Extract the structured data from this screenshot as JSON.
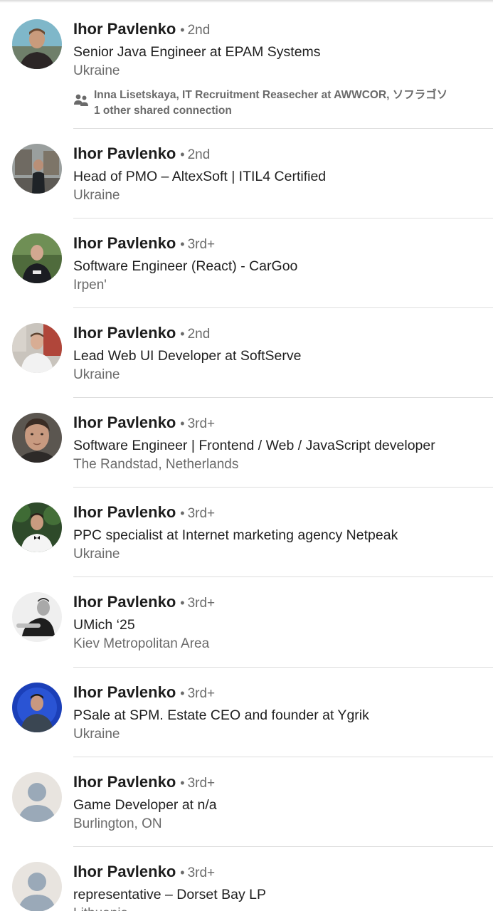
{
  "results": [
    {
      "name": "Ihor Pavlenko",
      "separator": "•",
      "degree": "2nd",
      "headline": "Senior Java Engineer at EPAM Systems",
      "location": "Ukraine",
      "avatar": "photo",
      "shared": {
        "icon": "people-icon",
        "line1": "Inna Lisetskaya, IT Recruitment Reasecher at AWWCOR, ソフラゴソ",
        "line2": "1 other shared connection"
      }
    },
    {
      "name": "Ihor Pavlenko",
      "separator": "•",
      "degree": "2nd",
      "headline": "Head of PMO – AltexSoft | ITIL4 Certified",
      "location": "Ukraine",
      "avatar": "photo"
    },
    {
      "name": "Ihor Pavlenko",
      "separator": "•",
      "degree": "3rd+",
      "headline": "Software Engineer (React) - CarGoo",
      "location": "Irpen'",
      "avatar": "photo"
    },
    {
      "name": "Ihor Pavlenko",
      "separator": "•",
      "degree": "2nd",
      "headline": "Lead Web UI Developer at SoftServe",
      "location": "Ukraine",
      "avatar": "photo"
    },
    {
      "name": "Ihor Pavlenko",
      "separator": "•",
      "degree": "3rd+",
      "headline": "Software Engineer | Frontend / Web / JavaScript developer",
      "location": "The Randstad, Netherlands",
      "avatar": "photo"
    },
    {
      "name": "Ihor Pavlenko",
      "separator": "•",
      "degree": "3rd+",
      "headline": "PPC specialist at Internet marketing agency Netpeak",
      "location": "Ukraine",
      "avatar": "photo"
    },
    {
      "name": "Ihor Pavlenko",
      "separator": "•",
      "degree": "3rd+",
      "headline": "UMich ‘25",
      "location": "Kiev Metropolitan Area",
      "avatar": "photo"
    },
    {
      "name": "Ihor Pavlenko",
      "separator": "•",
      "degree": "3rd+",
      "headline": "PSale at SPM. Estate CEO and founder at Ygrik",
      "location": "Ukraine",
      "avatar": "photo"
    },
    {
      "name": "Ihor Pavlenko",
      "separator": "•",
      "degree": "3rd+",
      "headline": "Game Developer at n/a",
      "location": "Burlington, ON",
      "avatar": "placeholder"
    },
    {
      "name": "Ihor Pavlenko",
      "separator": "•",
      "degree": "3rd+",
      "headline": "representative – Dorset Bay LP",
      "location": "Lithuania",
      "avatar": "placeholder"
    }
  ],
  "colors": {
    "name": "#1d1d1d",
    "secondary": "#6a6a6a",
    "divider": "#dedede",
    "placeholder_bg": "#e8e4df",
    "placeholder_figure": "#9aa9b8"
  }
}
